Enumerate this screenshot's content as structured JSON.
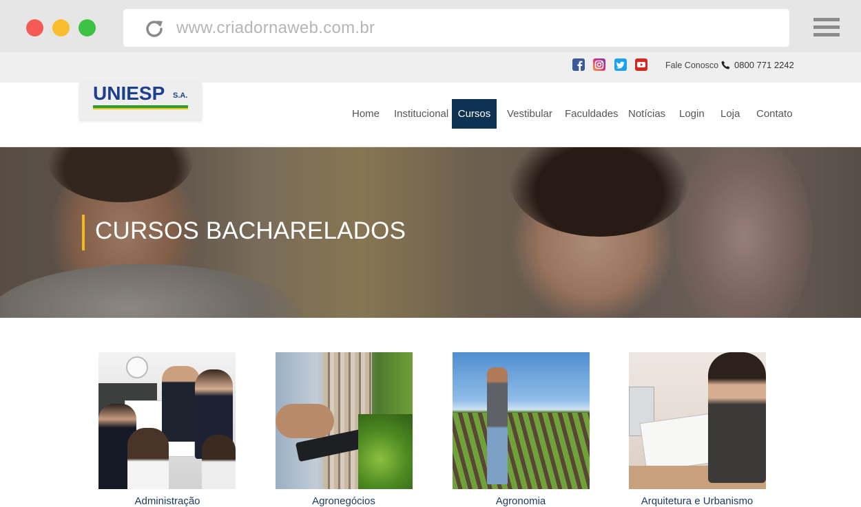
{
  "browser": {
    "url": "www.criadornaweb.com.br",
    "icons": [
      "close-dot",
      "minimize-dot",
      "maximize-dot",
      "reload-icon",
      "hamburger-menu-icon"
    ]
  },
  "topbar": {
    "social": [
      "facebook-icon",
      "instagram-icon",
      "twitter-icon",
      "youtube-icon"
    ],
    "contact_label": "Fale Conosco",
    "phone": "0800 771 2242"
  },
  "header": {
    "logo": "UNIESP",
    "logo_suffix": "S.A.",
    "nav": [
      {
        "label": "Home"
      },
      {
        "label": "Institucional"
      },
      {
        "label": "Cursos"
      },
      {
        "label": "Vestibular"
      },
      {
        "label": "Faculdades"
      },
      {
        "label": "Notícias"
      },
      {
        "label": "Login"
      },
      {
        "label": "Loja"
      },
      {
        "label": "Contato"
      }
    ],
    "active_nav": "Cursos"
  },
  "hero": {
    "title": "CURSOS BACHARELADOS"
  },
  "courses": [
    {
      "label": "Administração"
    },
    {
      "label": "Agronegócios"
    },
    {
      "label": "Agronomia"
    },
    {
      "label": "Arquitetura e Urbanismo"
    }
  ],
  "colors": {
    "nav_active": "#0d3252",
    "accent": "#f4b81f",
    "course_label": "#1b3a5c"
  }
}
